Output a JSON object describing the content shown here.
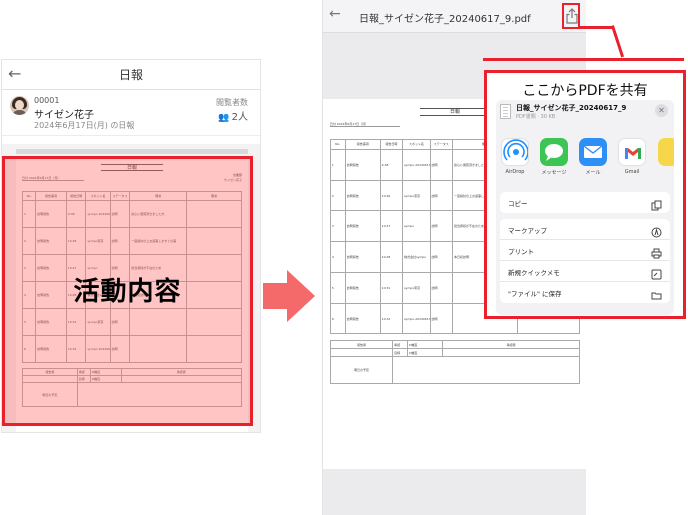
{
  "left_screen": {
    "header_title": "日報",
    "user": {
      "id": "00001",
      "name": "サイゼン花子",
      "date_line": "2024年6月17日(月) の日報"
    },
    "viewers": {
      "label": "閲覧者数",
      "count": "2人"
    },
    "overlay_label": "活動内容"
  },
  "right_screen": {
    "pdf_title": "日報_サイゼン花子_20240617_9.pdf"
  },
  "share_callout": "ここからPDFを共有",
  "share_sheet": {
    "file_name": "日報_サイゼン花子_20240617_9",
    "file_meta": "PDF書類 · 30 KB",
    "apps": [
      {
        "label": "AirDrop",
        "icon": "airdrop-icon"
      },
      {
        "label": "メッセージ",
        "icon": "messages-icon"
      },
      {
        "label": "メール",
        "icon": "mail-icon"
      },
      {
        "label": "Gmail",
        "icon": "gmail-icon"
      }
    ],
    "action_copy": "コピー",
    "actions": [
      {
        "label": "マークアップ",
        "icon": "markup-icon"
      },
      {
        "label": "プリント",
        "icon": "printer-icon"
      },
      {
        "label": "新規クイックメモ",
        "icon": "quick-note-icon"
      },
      {
        "label": "\"ファイル\" に保存",
        "icon": "folder-icon"
      }
    ]
  },
  "report": {
    "title": "日報",
    "date": "日付  2024年6月17日（月）",
    "dept": "営業部",
    "person": "サイゼン花子",
    "columns": [
      "No.",
      "報告事項",
      "報告日時",
      "スポット名",
      "ステータス",
      "備考",
      "備考"
    ],
    "rows": [
      [
        "1",
        "訪問報告",
        "9:38",
        "sympo-20240613-1",
        "訪問",
        "熱心に閲覧頂きましたが、",
        ""
      ],
      [
        "2",
        "訪問報告",
        "10:26",
        "sympo東京",
        "訪問",
        "一度検討の上お返事しますとの事",
        ""
      ],
      [
        "3",
        "訪問報告",
        "10:27",
        "sympo",
        "訪問",
        "担当者様が不在のため",
        ""
      ],
      [
        "4",
        "訪問報告",
        "10:28",
        "株式会社sympo",
        "訪問",
        "本日初訪問",
        ""
      ],
      [
        "5",
        "訪問報告",
        "10:31",
        "sympo東京",
        "訪問",
        "",
        ""
      ],
      [
        "6",
        "訪問報告",
        "10:32",
        "sympo-20240613-1",
        "訪問",
        "",
        ""
      ]
    ],
    "bottom": {
      "reporter_label": "報告者",
      "approval1": "承認",
      "approval2": "目標",
      "signer": "D橋直",
      "comment_label": "承認者",
      "next_label": "明日の予定"
    }
  }
}
